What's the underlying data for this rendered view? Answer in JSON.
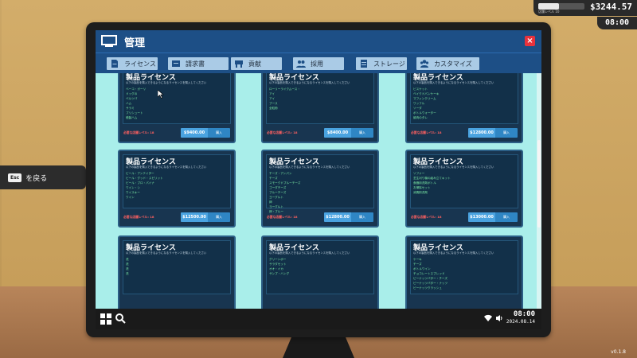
{
  "hud": {
    "level_label": "店舗レベル 10",
    "level_progress": 0.45,
    "money": "$3244.57",
    "time": "08:00"
  },
  "esc_hint": {
    "key": "Esc",
    "label": "を戻る"
  },
  "version": "v0.1.8",
  "window": {
    "title": "管理",
    "close": "×"
  },
  "tabs": [
    {
      "label": "ライセンス",
      "icon": "license-icon"
    },
    {
      "label": "請求書",
      "icon": "invoice-icon"
    },
    {
      "label": "貢献",
      "icon": "contribution-icon"
    },
    {
      "label": "採用",
      "icon": "hire-icon"
    },
    {
      "label": "ストレージ",
      "icon": "storage-icon"
    },
    {
      "label": "カスタマイズ",
      "icon": "customize-icon"
    }
  ],
  "cards": [
    {
      "title": "製品ライセンス",
      "desc": "以下の製品を購入できるようになるライセンスを購入してください",
      "items": [
        "ベーコ・ガーリ",
        "ドッグの",
        "ベルツバ",
        "ハム",
        "サラミ",
        "プリシュート",
        "燻製ハム"
      ],
      "requirement": "必要な店舗レベル: 18",
      "price": "$9400.00",
      "buy": "購入"
    },
    {
      "title": "製品ライセンス",
      "desc": "以下の製品を購入できるようになるライセンスを購入してください",
      "items": [
        "ローリーライクムース・",
        "アイ",
        "アイ",
        "ブース",
        "全粒粉"
      ],
      "requirement": "必要な店舗レベル: 18",
      "price": "$8400.00",
      "buy": "購入"
    },
    {
      "title": "製品ライセンス",
      "desc": "以下の製品を購入できるようになるライセンスを購入してください",
      "items": [
        "ビスケット",
        "ベイクドパンケーキ",
        "マフィンクリーム",
        "ワッフル",
        "ソーダ",
        "ボトルウォーター",
        "焼肉のタレ"
      ],
      "requirement": "必要な店舗レベル: 18",
      "price": "$12800.00",
      "buy": "購入"
    },
    {
      "title": "製品ライセンス",
      "desc": "以下の製品を購入できるようになるライセンスを購入してください",
      "items": [
        "ビール・アンテイター",
        "ビール・グッド・スピリット",
        "ビール・プロ・パイナ",
        "ワイン・シ",
        "ウイスキー",
        "ワイン"
      ],
      "requirement": "必要な店舗レベル: 18",
      "price": "$12500.00",
      "buy": "購入"
    },
    {
      "title": "製品ライセンス",
      "desc": "以下の製品を購入できるようになるライセンスを購入してください",
      "items": [
        "チーズ・アンパン",
        "チーズ",
        "スモークドブルーチーズ",
        "ゴーダチーズ",
        "ブルーチーズ",
        "ヨーグルト",
        "卵",
        "ヨーグルト",
        "卵・ブルー"
      ],
      "requirement": "必要な店舗レベル: 18",
      "price": "$12800.00",
      "buy": "購入"
    },
    {
      "title": "製品ライセンス",
      "desc": "以下の製品を購入できるようになるライセンスを購入してください",
      "items": [
        "ソファー",
        "芝生刈り機の組み立てキット",
        "食器用洗剤ボトル",
        "お掃除セット",
        "消臭剤洗剤"
      ],
      "requirement": "必要な店舗レベル: 18",
      "price": "$13000.00",
      "buy": "購入"
    },
    {
      "title": "製品ライセンス",
      "desc": "以下の製品を購入できるようになるライセンスを購入してください",
      "items": [
        "洗",
        "洗",
        "洗",
        "洗"
      ],
      "requirement": "",
      "price": "",
      "buy": ""
    },
    {
      "title": "製品ライセンス",
      "desc": "以下の製品を購入できるようになるライセンスを購入してください",
      "items": [
        "グリーンポー",
        "サラダセット",
        "オオ・イカ",
        "サンプ・ハング"
      ],
      "requirement": "",
      "price": "",
      "buy": ""
    },
    {
      "title": "製品ライセンス",
      "desc": "以下の製品を購入できるようになるライセンスを購入してください",
      "items": [
        "ケーキ",
        "チーズ",
        "ボトルワイン",
        "チョコレートスプレッド",
        "ピーナッツバター・チーズ",
        "ピーナッツバター・ナッツ",
        "ピーナッツクラッシュ"
      ],
      "requirement": "",
      "price": "",
      "buy": ""
    }
  ],
  "taskbar": {
    "time": "08:00",
    "date": "2024.08.14"
  }
}
